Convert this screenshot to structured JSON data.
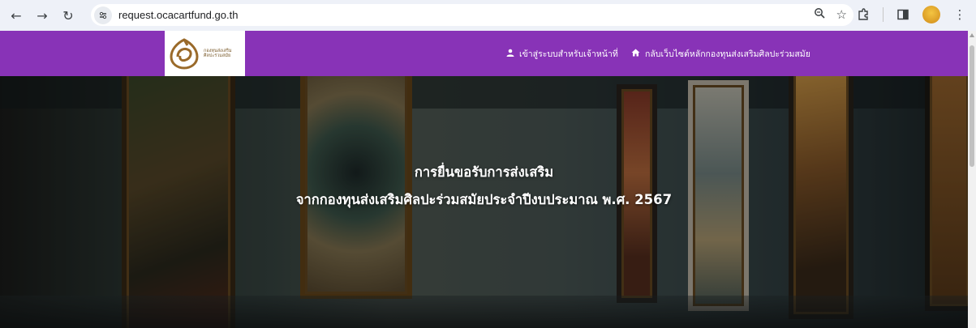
{
  "browser": {
    "url": "request.ocacartfund.go.th",
    "icons": [
      "back-icon",
      "forward-icon",
      "reload-icon",
      "site-info-icon",
      "zoom-icon",
      "bookmark-star-icon",
      "extensions-icon",
      "side-panel-icon",
      "profile-avatar",
      "menu-icon"
    ]
  },
  "header": {
    "logo_line1": "กองทุนส่งเสริม",
    "logo_line2": "ศิลปะร่วมสมัย",
    "nav_login": "เข้าสู่ระบบสำหรับเจ้าหน้าที่",
    "nav_home": "กลับเว็บไซต์หลักกองทุนส่งเสริมศิลปะร่วมสมัย",
    "bg_color": "#8833b7"
  },
  "hero": {
    "title_line1": "การยื่นขอรับการส่งเสริม",
    "title_line2": "จากกองทุนส่งเสริมศิลปะร่วมสมัยประจำปีงบประมาณ พ.ศ. 2567"
  }
}
